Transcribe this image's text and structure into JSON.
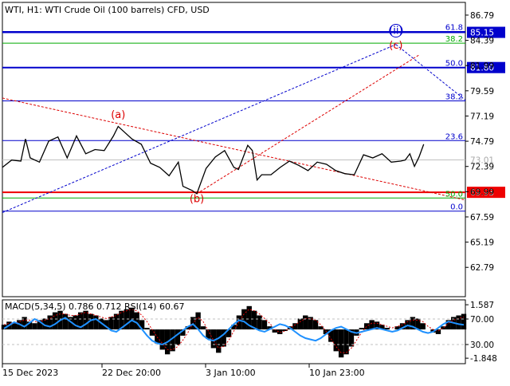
{
  "chart_data": {
    "type": "line",
    "title": "WTI, H1:  WTI Crude Oil (100 barrels) CFD, USD",
    "main_ylim": [
      60.0,
      88.0
    ],
    "y_ticks": [
      86.79,
      84.39,
      81.99,
      79.59,
      77.19,
      74.79,
      72.39,
      69.99,
      67.59,
      65.19,
      62.79
    ],
    "x_ticks": [
      "15 Dec 2023",
      "22 Dec 20:00",
      "3 Jan 10:00",
      "10 Jan 23:00"
    ],
    "price_series": {
      "name": "WTI H1",
      "x_range": [
        0,
        100
      ],
      "points": [
        [
          0,
          72.3
        ],
        [
          2,
          73.0
        ],
        [
          4,
          72.9
        ],
        [
          5,
          75.0
        ],
        [
          6,
          73.2
        ],
        [
          8,
          72.8
        ],
        [
          10,
          74.8
        ],
        [
          12,
          75.2
        ],
        [
          14,
          73.2
        ],
        [
          16,
          75.3
        ],
        [
          18,
          73.6
        ],
        [
          20,
          74.0
        ],
        [
          22,
          73.9
        ],
        [
          24,
          75.3
        ],
        [
          25,
          76.2
        ],
        [
          26,
          75.8
        ],
        [
          28,
          75.0
        ],
        [
          30,
          74.5
        ],
        [
          32,
          72.7
        ],
        [
          34,
          72.3
        ],
        [
          36,
          71.5
        ],
        [
          38,
          72.8
        ],
        [
          39,
          70.5
        ],
        [
          41,
          70.1
        ],
        [
          42,
          69.8
        ],
        [
          44,
          72.2
        ],
        [
          46,
          73.3
        ],
        [
          48,
          73.9
        ],
        [
          50,
          72.3
        ],
        [
          51,
          72.1
        ],
        [
          53,
          74.4
        ],
        [
          54,
          73.9
        ],
        [
          55,
          71.1
        ],
        [
          56,
          71.6
        ],
        [
          58,
          71.6
        ],
        [
          60,
          72.3
        ],
        [
          62,
          72.9
        ],
        [
          64,
          72.5
        ],
        [
          66,
          72.0
        ],
        [
          68,
          72.8
        ],
        [
          70,
          72.6
        ],
        [
          72,
          72.0
        ],
        [
          74,
          71.7
        ],
        [
          76,
          71.6
        ],
        [
          78,
          73.5
        ],
        [
          80,
          73.2
        ],
        [
          82,
          73.6
        ],
        [
          84,
          72.8
        ],
        [
          86,
          72.9
        ],
        [
          87,
          73.0
        ],
        [
          88,
          73.6
        ],
        [
          89,
          72.4
        ],
        [
          90,
          73.3
        ],
        [
          91,
          74.5
        ]
      ]
    },
    "horizontal_levels": [
      {
        "value": 85.15,
        "color": "#0000cc",
        "label": "85.15"
      },
      {
        "value": 81.8,
        "color": "#0000cc",
        "label": "81.80"
      },
      {
        "value": 69.93,
        "color": "#ee0000",
        "label": "69.93"
      }
    ],
    "fibonacci_levels": [
      {
        "label": "61.8",
        "value": 85.23,
        "color": "#0000cc"
      },
      {
        "label": "38.2",
        "value": 84.12,
        "color": "#00aa00"
      },
      {
        "label": "50.0",
        "value": 81.8,
        "color": "#0000cc"
      },
      {
        "label": "38.2",
        "value": 78.63,
        "color": "#0000cc"
      },
      {
        "label": "23.6",
        "value": 74.85,
        "color": "#0000cc"
      },
      {
        "label": "50.0",
        "value": 69.39,
        "color": "#00aa00"
      },
      {
        "label": "0.0",
        "value": 68.14,
        "color": "#0000cc"
      }
    ],
    "current_price": {
      "value": 73.01,
      "label": "73.01"
    },
    "wave_labels": [
      {
        "text": "(a)",
        "x": 25,
        "y": 77.0,
        "color": "#dd0000"
      },
      {
        "text": "(b)",
        "x": 42,
        "y": 69.0,
        "color": "#dd0000"
      },
      {
        "text": "(c)",
        "x": 85,
        "y": 83.6,
        "color": "#dd0000"
      },
      {
        "text": "(ii)",
        "x": 85,
        "y": 85.0,
        "color": "#0000cc"
      }
    ],
    "trend_lines": [
      {
        "from": [
          0,
          78.9
        ],
        "to": [
          100,
          69.2
        ],
        "color": "#dd0000",
        "dash": true
      },
      {
        "from": [
          0,
          68.0
        ],
        "to": [
          85,
          84.0
        ],
        "color": "#0000cc",
        "dash": true
      },
      {
        "from": [
          42,
          69.8
        ],
        "to": [
          90,
          83.0
        ],
        "color": "#dd0000",
        "dash": true
      },
      {
        "from": [
          85,
          84.0
        ],
        "to": [
          100,
          78.7
        ],
        "color": "#0000cc",
        "dash": true
      }
    ],
    "indicator": {
      "title": "MACD(5,34,5) 0.786 0.712 RSI(14) 60.67",
      "ylim": [
        -2.2,
        1.9
      ],
      "ticks": [
        "1.587",
        "70.00",
        "30.00",
        "-1.848"
      ],
      "macd_histogram": [
        0.3,
        0.5,
        0.4,
        0.6,
        0.8,
        0.5,
        0.4,
        0.6,
        0.7,
        0.9,
        1.1,
        1.2,
        1.0,
        0.8,
        0.9,
        1.1,
        1.2,
        1.0,
        0.9,
        0.7,
        0.6,
        0.8,
        1.0,
        1.2,
        1.3,
        1.4,
        1.1,
        0.6,
        0.1,
        -0.4,
        -0.9,
        -1.3,
        -1.6,
        -1.4,
        -1.0,
        -0.4,
        0.2,
        0.8,
        1.1,
        0.2,
        -0.6,
        -1.2,
        -1.5,
        -1.1,
        -0.5,
        0.3,
        0.9,
        1.3,
        1.5,
        1.2,
        0.9,
        0.6,
        0.2,
        -0.2,
        -0.3,
        -0.1,
        0.2,
        0.4,
        0.7,
        0.9,
        0.8,
        0.6,
        0.2,
        -0.3,
        -0.8,
        -1.4,
        -1.8,
        -1.6,
        -1.1,
        -0.4,
        0.1,
        0.4,
        0.6,
        0.5,
        0.3,
        0.1,
        0.0,
        0.2,
        0.4,
        0.6,
        0.8,
        0.7,
        0.4,
        0.0,
        -0.2,
        -0.3,
        0.2,
        0.6,
        0.8,
        0.9,
        1.0
      ],
      "signal_line": [
        0.3,
        0.4,
        0.4,
        0.5,
        0.6,
        0.6,
        0.5,
        0.5,
        0.6,
        0.7,
        0.9,
        1.0,
        1.0,
        0.9,
        0.9,
        1.0,
        1.1,
        1.0,
        0.9,
        0.8,
        0.7,
        0.8,
        0.9,
        1.1,
        1.2,
        1.3,
        1.2,
        0.9,
        0.5,
        0.0,
        -0.5,
        -0.9,
        -1.3,
        -1.3,
        -1.1,
        -0.7,
        -0.2,
        0.4,
        0.8,
        0.5,
        -0.1,
        -0.7,
        -1.2,
        -1.1,
        -0.7,
        -0.1,
        0.5,
        1.0,
        1.3,
        1.2,
        1.0,
        0.7,
        0.4,
        0.0,
        -0.2,
        -0.1,
        0.1,
        0.3,
        0.5,
        0.7,
        0.7,
        0.6,
        0.3,
        -0.1,
        -0.6,
        -1.1,
        -1.5,
        -1.5,
        -1.2,
        -0.7,
        -0.2,
        0.2,
        0.4,
        0.4,
        0.3,
        0.2,
        0.1,
        0.2,
        0.3,
        0.5,
        0.6,
        0.6,
        0.5,
        0.2,
        0.0,
        -0.1,
        0.1,
        0.4,
        0.6,
        0.7,
        0.8
      ],
      "rsi": [
        55,
        60,
        65,
        62,
        58,
        64,
        70,
        66,
        60,
        58,
        62,
        68,
        72,
        66,
        60,
        57,
        62,
        68,
        70,
        64,
        58,
        52,
        50,
        56,
        62,
        68,
        64,
        54,
        44,
        36,
        32,
        30,
        34,
        40,
        46,
        52,
        58,
        62,
        54,
        44,
        38,
        36,
        40,
        46,
        54,
        62,
        68,
        66,
        60,
        56,
        52,
        50,
        54,
        58,
        62,
        60,
        56,
        50,
        44,
        40,
        38,
        36,
        40,
        46,
        52,
        56,
        58,
        54,
        50,
        48,
        50,
        52,
        54,
        56,
        54,
        52,
        50,
        52,
        56,
        60,
        58,
        54,
        50,
        48,
        50,
        56,
        62,
        66,
        64,
        62,
        61
      ]
    }
  }
}
